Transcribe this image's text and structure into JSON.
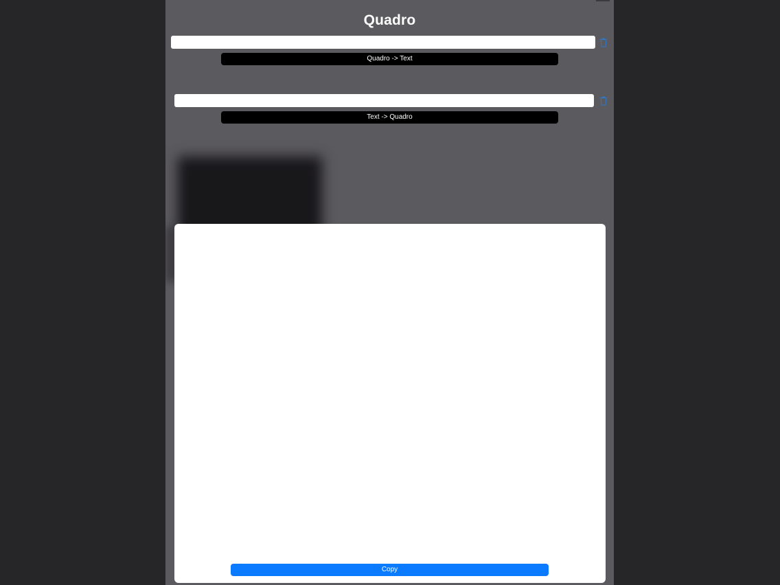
{
  "app": {
    "title": "Quadro"
  },
  "decode": {
    "input_value": "",
    "input_placeholder": "",
    "button_label": "Quadro -> Text",
    "clear_icon": "trash-icon"
  },
  "encode": {
    "input_value": "",
    "input_placeholder": "",
    "button_label": "Text -> Quadro",
    "clear_icon": "trash-icon"
  },
  "result": {
    "text": "",
    "copy_label": "Copy"
  },
  "colors": {
    "background": "#262528",
    "app_background": "#5b5a5e",
    "convert_button": "#000000",
    "copy_button": "#0a7afe",
    "icon_accent": "#2f78c8"
  }
}
